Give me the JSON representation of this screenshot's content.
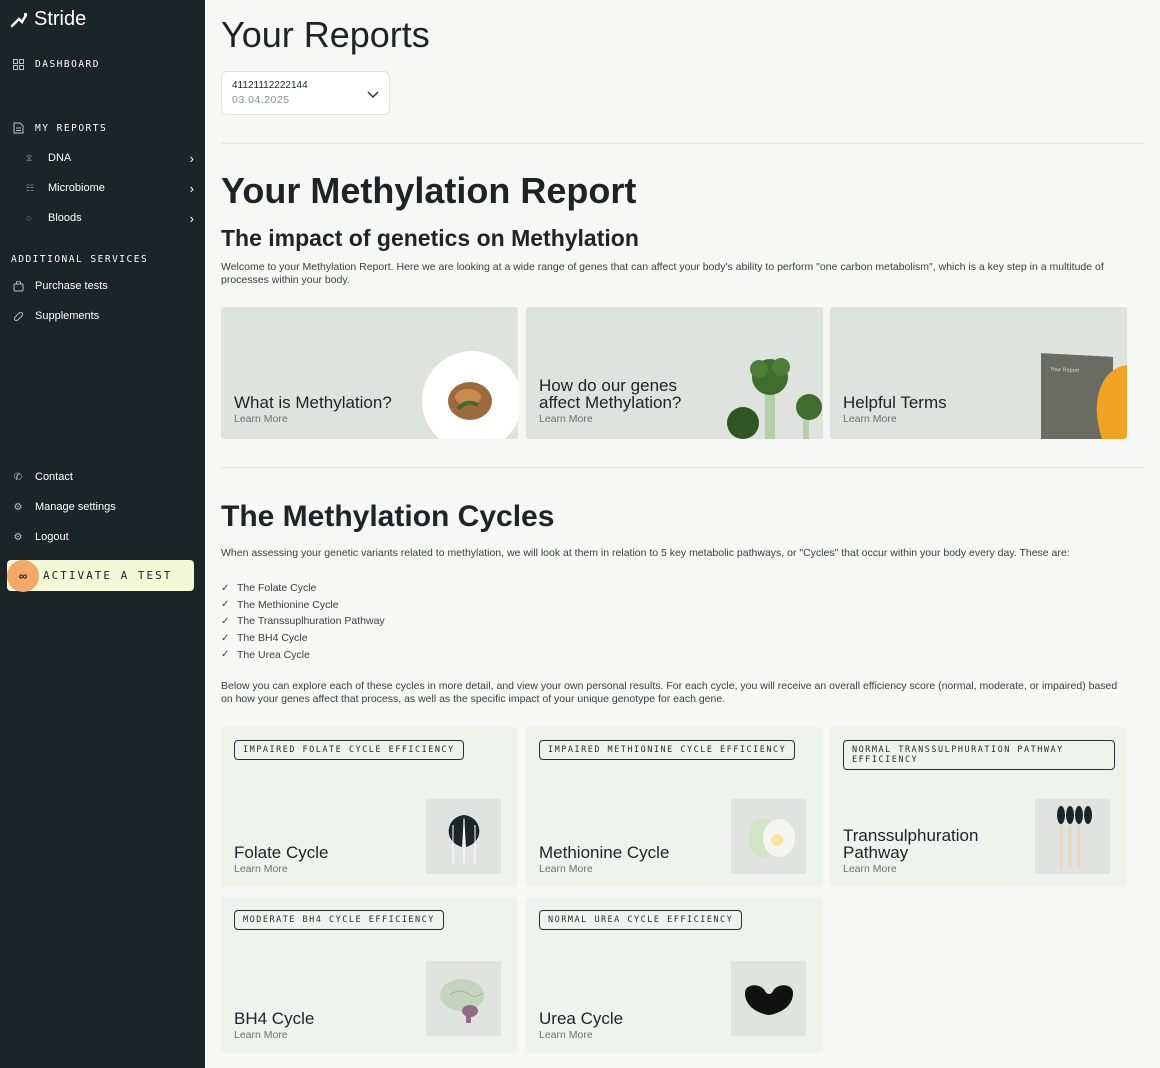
{
  "app": {
    "name": "Stride"
  },
  "sidebar": {
    "dashboard": "DASHBOARD",
    "my_reports": "MY REPORTS",
    "reports": [
      {
        "label": "DNA",
        "icon": "dna-icon"
      },
      {
        "label": "Microbiome",
        "icon": "microbiome-icon"
      },
      {
        "label": "Bloods",
        "icon": "blood-drop-icon"
      }
    ],
    "additional_services": "ADDITIONAL SERVICES",
    "services": [
      {
        "label": "Purchase tests",
        "icon": "bag-icon"
      },
      {
        "label": "Supplements",
        "icon": "pill-icon"
      }
    ],
    "footer": [
      {
        "label": "Contact",
        "icon": "phone-icon"
      },
      {
        "label": "Manage settings",
        "icon": "gear-icon"
      },
      {
        "label": "Logout",
        "icon": "logout-icon"
      }
    ],
    "activate": "ACTIVATE A TEST"
  },
  "header": {
    "title": "Your Reports"
  },
  "report_selector": {
    "id": "41121112222144",
    "date": "03.04.2025"
  },
  "methylation": {
    "title": "Your Methylation Report",
    "subtitle": "The impact of genetics on Methylation",
    "welcome": "Welcome to your Methylation Report. Here we are looking at a wide range of genes that can affect your body's ability to perform \"one carbon metabolism\", which is a key step in a multitude of processes within your body.",
    "info_cards": [
      {
        "title": "What is Methylation?",
        "link": "Learn More"
      },
      {
        "title": "How do our genes affect Methylation?",
        "link": "Learn More"
      },
      {
        "title": "Helpful Terms",
        "link": "Learn More",
        "image_text": "Your Report"
      }
    ]
  },
  "cycles": {
    "title": "The Methylation Cycles",
    "intro": "When assessing your genetic variants related to methylation, we will look at them in relation to 5 key metabolic pathways, or \"Cycles\" that occur within your body every day. These are:",
    "list": [
      "The Folate Cycle",
      "The Methionine Cycle",
      "The Transsuplhuration Pathway",
      "The BH4 Cycle",
      "The Urea Cycle"
    ],
    "below": "Below you can explore each of these cycles in more detail, and view your own personal results. For each cycle, you will receive an overall efficiency score (normal, moderate, or impaired) based on how your genes affect that process, as well as the specific impact of your unique genotype for each gene.",
    "cards": [
      {
        "tag": "IMPAIRED FOLATE CYCLE EFFICIENCY",
        "title": "Folate Cycle",
        "link": "Learn More",
        "icon": "leaf-icon"
      },
      {
        "tag": "IMPAIRED METHIONINE CYCLE EFFICIENCY",
        "title": "Methionine Cycle",
        "link": "Learn More",
        "icon": "egg-icon"
      },
      {
        "tag": "NORMAL TRANSSULPHURATION PATHWAY EFFICIENCY",
        "title": "Transsulphuration Pathway",
        "link": "Learn More",
        "icon": "matches-icon"
      },
      {
        "tag": "MODERATE BH4 CYCLE EFFICIENCY",
        "title": "BH4 Cycle",
        "link": "Learn More",
        "icon": "brain-icon"
      },
      {
        "tag": "NORMAL UREA CYCLE EFFICIENCY",
        "title": "Urea Cycle",
        "link": "Learn More",
        "icon": "kidney-bean-icon"
      }
    ]
  },
  "colors": {
    "sidebar_bg": "#1b2427",
    "accent": "#f4a86a",
    "activate_bg": "#f3f8d6",
    "card_bg": "#eef3ee"
  }
}
